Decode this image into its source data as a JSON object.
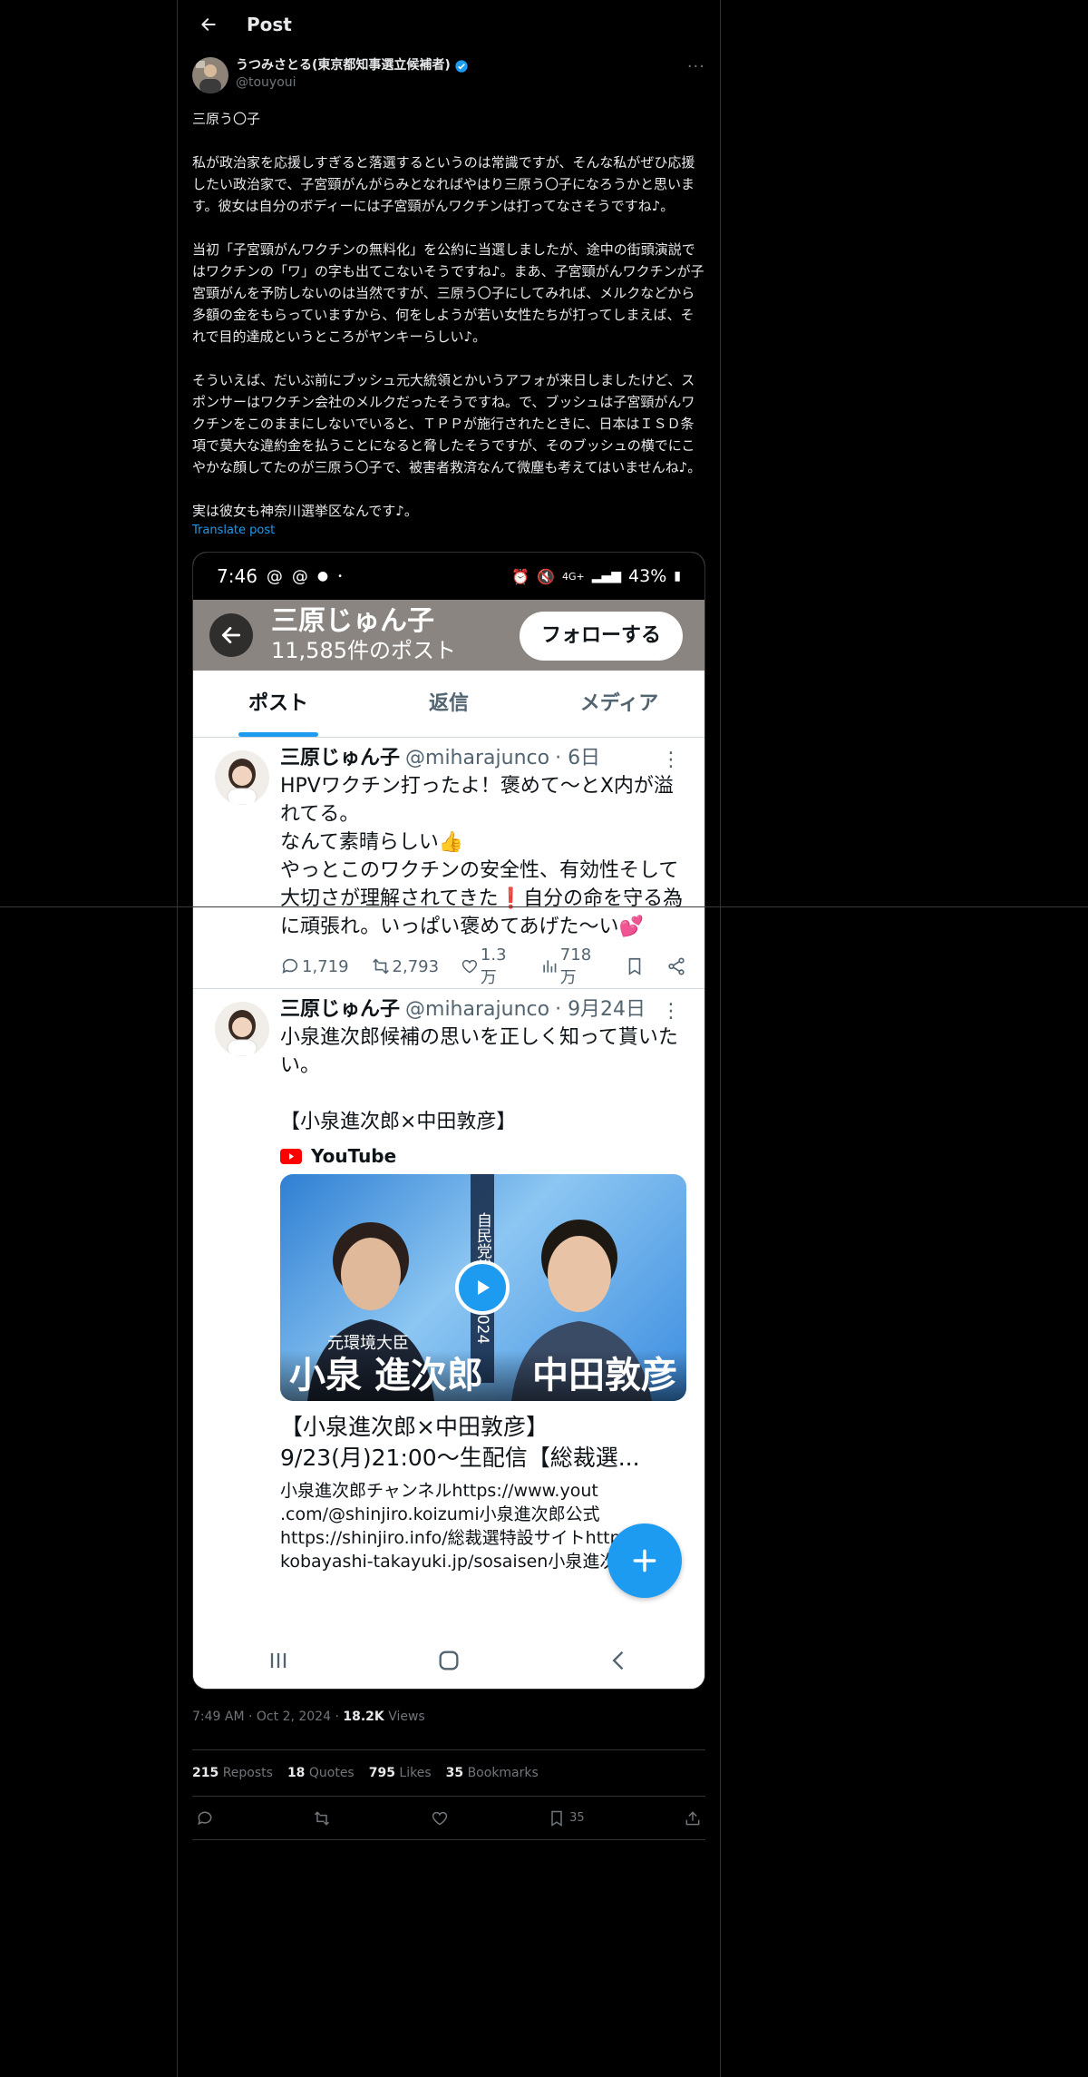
{
  "header": {
    "title": "Post"
  },
  "author": {
    "name": "うつみさとる(東京都知事選立候補者)",
    "handle": "@touyoui"
  },
  "post": {
    "text": "三原う〇子\n\n私が政治家を応援しすぎると落選するというのは常識ですが、そんな私がぜひ応援したい政治家で、子宮頸がんがらみとなればやはり三原う〇子になろうかと思います。彼女は自分のボディーには子宮頸がんワクチンは打ってなさそうですね♪。\n\n当初「子宮頸がんワクチンの無料化」を公約に当選しましたが、途中の街頭演説ではワクチンの「ワ」の字も出てこないそうですね♪。まあ、子宮頸がんワクチンが子宮頸がんを予防しないのは当然ですが、三原う〇子にしてみれば、メルクなどから多額の金をもらっていますから、何をしようが若い女性たちが打ってしまえば、それで目的達成というところがヤンキーらしい♪。\n\nそういえば、だいぶ前にブッシュ元大統領とかいうアフォが来日しましたけど、スポンサーはワクチン会社のメルクだったそうですね。で、ブッシュは子宮頸がんワクチンをこのままにしないでいると、ＴＰＰが施行されたときに、日本はＩＳＤ条項で莫大な違約金を払うことになると脅したそうですが、そのブッシュの横でにこやかな顔してたのが三原う〇子で、被害者救済なんて微塵も考えてはいませんね♪。\n\n実は彼女も神奈川選挙区なんです♪。",
    "translate": "Translate post"
  },
  "screenshot": {
    "status": {
      "time": "7:46",
      "battery": "43%",
      "net": "4G+"
    },
    "profile": {
      "name": "三原じゅん子",
      "count": "11,585件のポスト",
      "follow": "フォローする"
    },
    "tabs": [
      "ポスト",
      "返信",
      "メディア"
    ],
    "tweets": [
      {
        "name": "三原じゅん子",
        "handle": "@miharajunco",
        "time": "· 6日",
        "text": "HPVワクチン打ったよ！褒めて〜とX内が溢れてる。\nなんて素晴らしい👍\nやっとこのワクチンの安全性、有効性そして大切さが理解されてきた❗自分の命を守る為に頑張れ。いっぱい褒めてあげた〜い💕",
        "replies": "1,719",
        "reposts": "2,793",
        "likes": "1.3万",
        "views": "718万"
      },
      {
        "name": "三原じゅん子",
        "handle": "@miharajunco",
        "time": "· 9月24日",
        "text": "小泉進次郎候補の思いを正しく知って貰いたい。\n\n【小泉進次郎×中田敦彦】",
        "yt_label": "YouTube",
        "thumb_vertical": "自民党総裁選2024",
        "thumb_sub": "元環境大臣",
        "thumb_left": "小泉 進次郎",
        "thumb_right": "中田敦彦",
        "video_title": "【小泉進次郎×中田敦彦】\n9/23(月)21:00〜生配信【総裁選...",
        "video_desc": "小泉進次郎チャンネルhttps://www.yout\n.com/@shinjiro.koizumi小泉進次郎公式\nhttps://shinjiro.info/総裁選特設サイトhttp\nkobayashi-takayuki.jp/sosaisen小泉進次郎公..."
      }
    ]
  },
  "meta": {
    "time": "7:49 AM",
    "date": "Oct 2, 2024",
    "views_count": "18.2K",
    "views_label": "Views"
  },
  "stats": {
    "reposts_count": "215",
    "reposts_label": "Reposts",
    "quotes_count": "18",
    "quotes_label": "Quotes",
    "likes_count": "795",
    "likes_label": "Likes",
    "bookmarks_count": "35",
    "bookmarks_label": "Bookmarks"
  },
  "actions": {
    "bookmark_count": "35"
  },
  "colors": {
    "accent": "#1d9bf0",
    "background": "#000000",
    "border": "#2f3336",
    "muted": "#71767b"
  }
}
